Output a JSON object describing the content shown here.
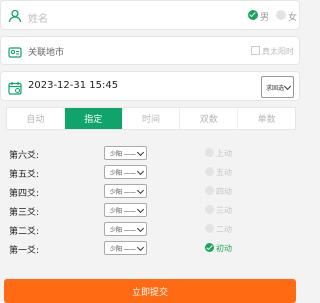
{
  "name_row": {
    "placeholder": "姓名",
    "gender_male": "男",
    "gender_female": "女"
  },
  "city_row": {
    "placeholder": "关联地市",
    "dst_label": "真太阳时"
  },
  "date_row": {
    "value": "2023-12-31 15:45",
    "calendar_select": "求固选"
  },
  "tabs": [
    {
      "label": "自动",
      "active": false
    },
    {
      "label": "指定",
      "active": true
    },
    {
      "label": "时间",
      "active": false
    },
    {
      "label": "双数",
      "active": false
    },
    {
      "label": "单数",
      "active": false
    }
  ],
  "lines": [
    {
      "label": "第六爻:",
      "select": "少阳 ——",
      "dong": "上动",
      "checked": false
    },
    {
      "label": "第五爻:",
      "select": "少阳 ——",
      "dong": "五动",
      "checked": false
    },
    {
      "label": "第四爻:",
      "select": "少阳 ——",
      "dong": "四动",
      "checked": false
    },
    {
      "label": "第三爻:",
      "select": "少阳 ——",
      "dong": "三动",
      "checked": false
    },
    {
      "label": "第二爻:",
      "select": "少阳 ——",
      "dong": "二动",
      "checked": false
    },
    {
      "label": "第一爻:",
      "select": "少阳 ——",
      "dong": "初动",
      "checked": true
    }
  ],
  "submit_label": "立即提交",
  "colors": {
    "accent_green": "#10a36a",
    "submit_orange": "#ff6a13"
  }
}
